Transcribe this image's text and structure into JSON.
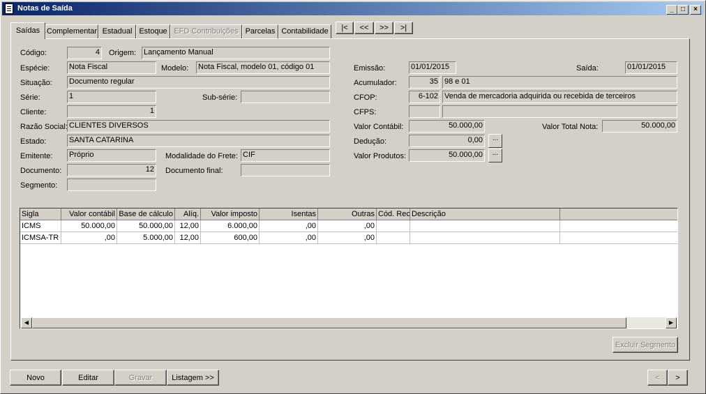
{
  "window": {
    "title": "Notas de Saída"
  },
  "tabs": [
    "Saídas",
    "Complementar",
    "Estadual",
    "Estoque",
    "EFD Contribuições",
    "Parcelas",
    "Contabilidade"
  ],
  "nav_buttons": [
    "|<",
    "<<",
    ">>",
    ">|"
  ],
  "form": {
    "codigo": {
      "label": "Código:",
      "value": "4"
    },
    "origem": {
      "label": "Origem:",
      "value": "Lançamento Manual"
    },
    "especie": {
      "label": "Espécie:",
      "value": "Nota Fiscal"
    },
    "modelo": {
      "label": "Modelo:",
      "value": "Nota Fiscal, modelo 01, código 01"
    },
    "situacao": {
      "label": "Situação:",
      "value": "Documento regular"
    },
    "serie": {
      "label": "Série:",
      "value": "1"
    },
    "subserie": {
      "label": "Sub-série:",
      "value": ""
    },
    "cliente": {
      "label": "Cliente:",
      "value": "1"
    },
    "razao_social": {
      "label": "Razão Social:",
      "value": "CLIENTES DIVERSOS"
    },
    "estado": {
      "label": "Estado:",
      "value": "SANTA CATARINA"
    },
    "emitente": {
      "label": "Emitente:",
      "value": "Próprio"
    },
    "modalidade_frete": {
      "label": "Modalidade do Frete:",
      "value": "CIF"
    },
    "documento": {
      "label": "Documento:",
      "value": "12"
    },
    "documento_final": {
      "label": "Documento final:",
      "value": ""
    },
    "segmento": {
      "label": "Segmento:",
      "value": ""
    },
    "emissao": {
      "label": "Emissão:",
      "value": "01/01/2015"
    },
    "saida": {
      "label": "Saída:",
      "value": "01/01/2015"
    },
    "acumulador": {
      "label": "Acumulador:",
      "code": "35",
      "desc": "98 e 01"
    },
    "cfop": {
      "label": "CFOP:",
      "code": "6-102",
      "desc": "Venda de mercadoria adquirida ou recebida de terceiros"
    },
    "cfps": {
      "label": "CFPS:",
      "code": "",
      "desc": ""
    },
    "valor_contabil": {
      "label": "Valor Contábil:",
      "value": "50.000,00"
    },
    "valor_total_nota": {
      "label": "Valor Total Nota:",
      "value": "50.000,00"
    },
    "deducao": {
      "label": "Dedução:",
      "value": "0,00"
    },
    "valor_produtos": {
      "label": "Valor Produtos:",
      "value": "50.000,00"
    },
    "ellipsis": "..."
  },
  "grid": {
    "headers": [
      "Sigla",
      "Valor contábil",
      "Base de cálculo",
      "Alíq.",
      "Valor imposto",
      "Isentas",
      "Outras",
      "Cód. Rec.",
      "Descrição"
    ],
    "rows": [
      [
        "ICMS",
        "50.000,00",
        "50.000,00",
        "12,00",
        "6.000,00",
        ",00",
        ",00",
        "",
        ""
      ],
      [
        "ICMSA-TR",
        ",00",
        "5.000,00",
        "12,00",
        "600,00",
        ",00",
        ",00",
        "",
        ""
      ]
    ]
  },
  "buttons": {
    "excluir_segmento": "Excluir Segmento",
    "novo": "Novo",
    "editar": "Editar",
    "gravar": "Gravar",
    "listagem": "Listagem >>",
    "prev": "<",
    "next": ">"
  }
}
